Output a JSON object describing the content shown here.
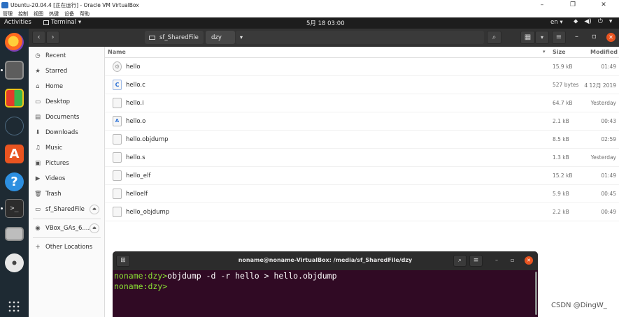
{
  "vbox": {
    "title": "Ubuntu-20.04.4 [正在运行] - Oracle VM VirtualBox",
    "menu": [
      "管理",
      "控制",
      "视图",
      "热键",
      "设备",
      "帮助"
    ],
    "minimize": "–",
    "restore": "❐",
    "close": "✕"
  },
  "topbar": {
    "activities": "Activities",
    "app_name": "Terminal",
    "app_chevron": "▾",
    "clock": "5月 18  03:00",
    "input_lang": "en",
    "input_chevron": "▾",
    "network": "⬥",
    "sound": "◀)",
    "power": "⏻",
    "sys_chevron": "▾"
  },
  "header": {
    "back": "‹",
    "forward": "›",
    "crumb_1": "sf_SharedFile",
    "crumb_2": "dzy",
    "crumb_2_chevron": "▾",
    "search": "⌕",
    "view": "▦",
    "view_chevron": "▾",
    "menu": "≡",
    "minimize": "–",
    "restore": "▫",
    "close": "✕"
  },
  "sidebar": {
    "items": [
      {
        "label": "Recent",
        "icon": "◷"
      },
      {
        "label": "Starred",
        "icon": "★"
      },
      {
        "label": "Home",
        "icon": "⌂"
      },
      {
        "label": "Desktop",
        "icon": "▭"
      },
      {
        "label": "Documents",
        "icon": "▤"
      },
      {
        "label": "Downloads",
        "icon": "⬇"
      },
      {
        "label": "Music",
        "icon": "♫"
      },
      {
        "label": "Pictures",
        "icon": "▣"
      },
      {
        "label": "Videos",
        "icon": "▶"
      },
      {
        "label": "Trash",
        "icon": "🗑"
      },
      {
        "label": "sf_SharedFile",
        "icon": "▭",
        "eject": "⏏"
      }
    ],
    "devices": [
      {
        "label": "VBox_GAs_6....",
        "icon": "◉",
        "eject": "⏏"
      }
    ],
    "other": {
      "label": "Other Locations",
      "icon": "+"
    }
  },
  "columns": {
    "name": "Name",
    "sort": "▾",
    "size": "Size",
    "modified": "Modified"
  },
  "files": [
    {
      "icon": "⚙",
      "name": "hello",
      "size": "15.9 kB",
      "modified": "01:49"
    },
    {
      "icon": "C",
      "name": "hello.c",
      "size": "527 bytes",
      "modified": "4 12月 2019"
    },
    {
      "icon": "",
      "name": "hello.i",
      "size": "64.7 kB",
      "modified": "Yesterday"
    },
    {
      "icon": "A",
      "name": "hello.o",
      "size": "2.1 kB",
      "modified": "00:43"
    },
    {
      "icon": "",
      "name": "hello.objdump",
      "size": "8.5 kB",
      "modified": "02:59"
    },
    {
      "icon": "",
      "name": "hello.s",
      "size": "1.3 kB",
      "modified": "Yesterday"
    },
    {
      "icon": "",
      "name": "hello_elf",
      "size": "15.2 kB",
      "modified": "01:49"
    },
    {
      "icon": "",
      "name": "helloelf",
      "size": "5.9 kB",
      "modified": "00:45"
    },
    {
      "icon": "",
      "name": "hello_objdump",
      "size": "2.2 kB",
      "modified": "00:49"
    }
  ],
  "terminal": {
    "new_tab": "⊞",
    "title": "noname@noname-VirtualBox: /media/sf_SharedFile/dzy",
    "search": "⌕",
    "menu": "≡",
    "minimize": "–",
    "restore": "▫",
    "close": "✕",
    "lines": [
      {
        "prompt": "noname:dzy>",
        "cmd": "objdump -d -r hello > hello.objdump"
      },
      {
        "prompt": "noname:dzy>",
        "cmd": ""
      }
    ]
  },
  "watermark": "CSDN @DingW_",
  "colors": {
    "accent": "#e95420",
    "prompt": "#8ae234",
    "terminal_bg": "#300a24"
  }
}
